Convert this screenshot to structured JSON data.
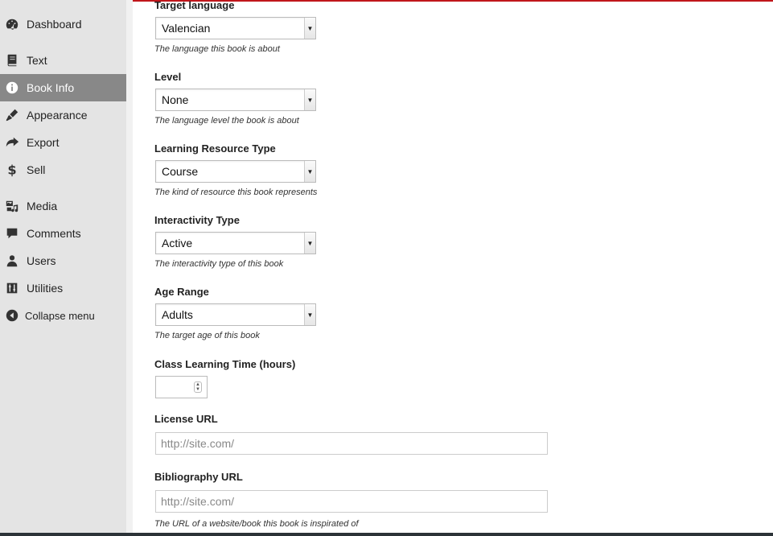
{
  "sidebar": {
    "items": [
      {
        "label": "Dashboard",
        "icon": "dashboard-icon"
      },
      {
        "label": "Text",
        "icon": "book-icon"
      },
      {
        "label": "Book Info",
        "icon": "info-icon"
      },
      {
        "label": "Appearance",
        "icon": "brush-icon"
      },
      {
        "label": "Export",
        "icon": "share-icon"
      },
      {
        "label": "Sell",
        "icon": "dollar-icon"
      },
      {
        "label": "Media",
        "icon": "media-icon"
      },
      {
        "label": "Comments",
        "icon": "comment-icon"
      },
      {
        "label": "Users",
        "icon": "user-icon"
      },
      {
        "label": "Utilities",
        "icon": "tools-icon"
      },
      {
        "label": "Collapse menu",
        "icon": "collapse-icon"
      }
    ],
    "active_item": "Book Info",
    "active_color": "#888888"
  },
  "form": {
    "target_language": {
      "label": "Target language",
      "value": "Valencian",
      "description": "The language this book is about"
    },
    "level": {
      "label": "Level",
      "value": "None",
      "description": "The language level the book is about"
    },
    "learning_resource_type": {
      "label": "Learning Resource Type",
      "value": "Course",
      "description": "The kind of resource this book represents"
    },
    "interactivity_type": {
      "label": "Interactivity Type",
      "value": "Active",
      "description": "The interactivity type of this book"
    },
    "age_range": {
      "label": "Age Range",
      "value": "Adults",
      "description": "The target age of this book"
    },
    "class_learning_time": {
      "label": "Class Learning Time (hours)",
      "value": ""
    },
    "license_url": {
      "label": "License URL",
      "placeholder": "http://site.com/"
    },
    "bibliography_url": {
      "label": "Bibliography URL",
      "placeholder": "http://site.com/",
      "description": "The URL of a website/book this book is inspirated of"
    }
  },
  "colors": {
    "accent_strip": "#c0161b",
    "sidebar_bg": "#e4e4e4"
  }
}
